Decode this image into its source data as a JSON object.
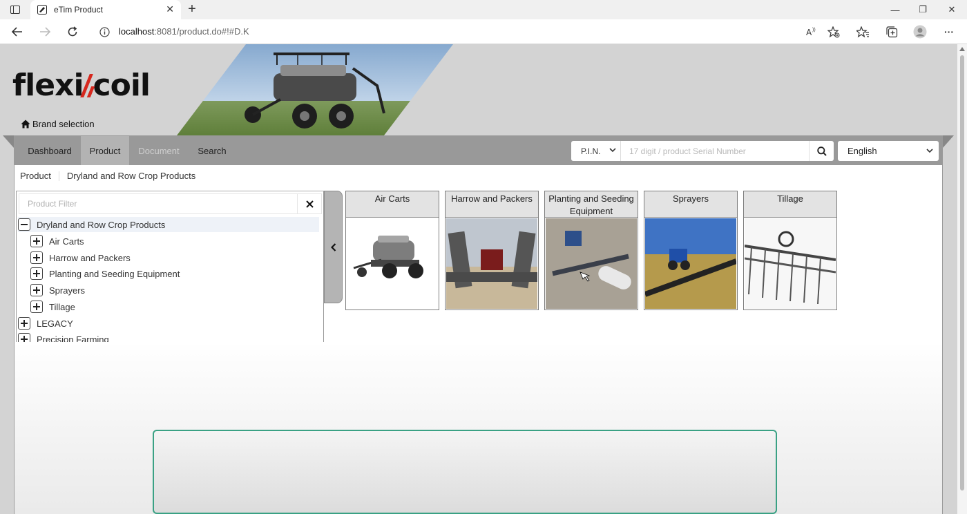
{
  "browser": {
    "tab_title": "eTim Product",
    "tab_close": "✕",
    "new_tab": "+",
    "url_host": "localhost",
    "url_rest": ":8081/product.do#!#D.K",
    "win_min": "—",
    "win_max": "❐",
    "win_close": "✕",
    "more": "···"
  },
  "brand": {
    "logo_left": "flexi",
    "logo_right": "coil",
    "brand_selection": "Brand selection"
  },
  "nav": {
    "items": [
      "Dashboard",
      "Product",
      "Document",
      "Search"
    ],
    "pin_type": "P.I.N.",
    "pin_placeholder": "17 digit / product Serial Number",
    "language": "English"
  },
  "breadcrumb": [
    "Product",
    "Dryland and Row Crop Products"
  ],
  "tree": {
    "filter_placeholder": "Product Filter",
    "root": "Dryland and Row Crop Products",
    "children": [
      "Air Carts",
      "Harrow and Packers",
      "Planting and Seeding Equipment",
      "Sprayers",
      "Tillage"
    ],
    "others": [
      "LEGACY",
      "Precision Farming"
    ]
  },
  "cards": [
    {
      "title": "Air Carts"
    },
    {
      "title": "Harrow and Packers"
    },
    {
      "title": "Planting and Seeding Equipment"
    },
    {
      "title": "Sprayers"
    },
    {
      "title": "Tillage"
    }
  ],
  "colors": {
    "navbar": "#999999",
    "nav_active": "#b3b3b3",
    "logo_accent": "#d6281e",
    "box_border": "#3aa184"
  }
}
